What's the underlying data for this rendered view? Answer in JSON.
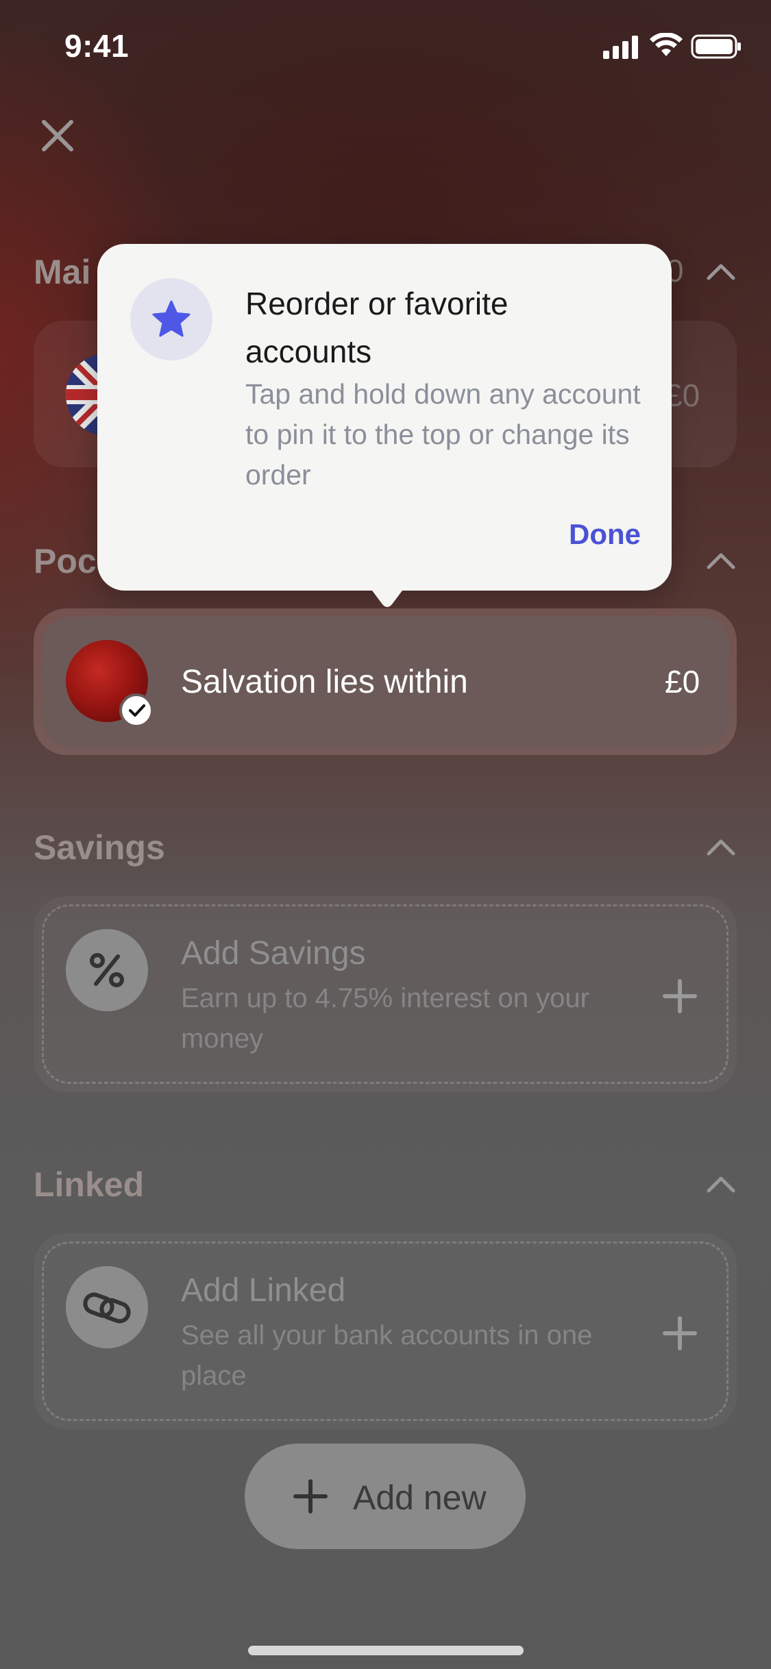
{
  "status_bar": {
    "time": "9:41"
  },
  "sections": {
    "main": {
      "title": "Mai",
      "total": "0",
      "amount": "£0"
    },
    "pockets": {
      "title": "Poc"
    },
    "savings": {
      "title": "Savings"
    },
    "linked": {
      "title": "Linked"
    }
  },
  "tooltip": {
    "title": "Reorder or favorite accounts",
    "body": "Tap and hold down any account to pin it to the top or change its order",
    "done_label": "Done"
  },
  "pocket": {
    "name": "Salvation lies within",
    "amount": "£0"
  },
  "savings_card": {
    "title": "Add Savings",
    "description": "Earn up to 4.75% interest on your money"
  },
  "linked_card": {
    "title": "Add Linked",
    "description": "See all your bank accounts in one place"
  },
  "add_new_label": "Add new",
  "colors": {
    "accent": "#4a52d6",
    "tooltip_bg": "#f5f5f3"
  }
}
